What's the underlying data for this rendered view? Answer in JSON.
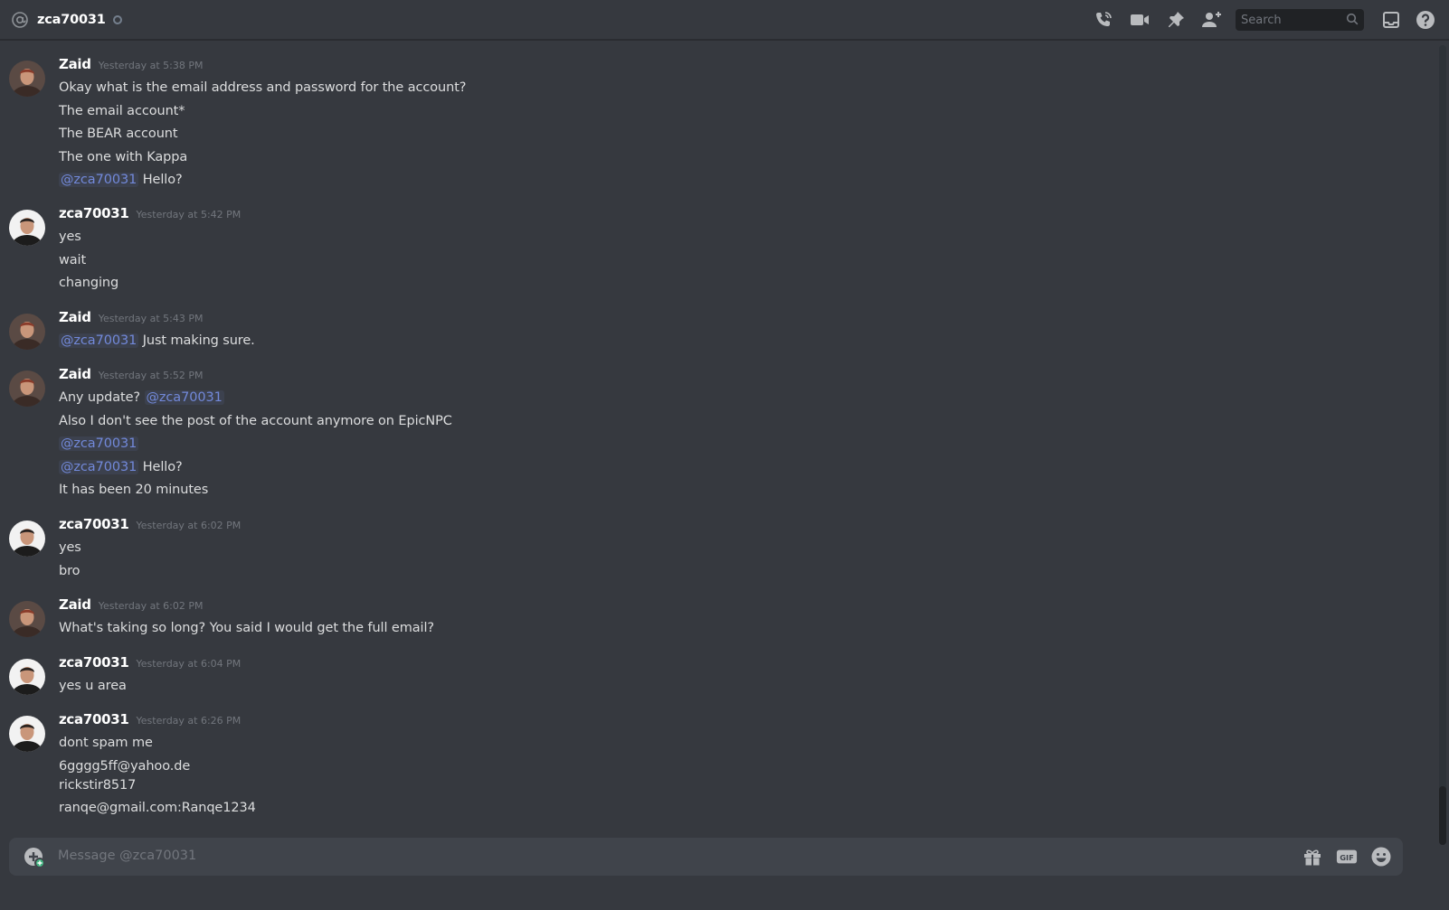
{
  "header": {
    "title": "zca70031",
    "search_placeholder": "Search",
    "icons": [
      "at-icon",
      "call-icon",
      "video-icon",
      "pin-icon",
      "add-friend-icon",
      "search-icon",
      "inbox-icon",
      "help-icon"
    ]
  },
  "colors": {
    "background": "#36393f",
    "mention": "#7289da",
    "timestamp": "#72767d",
    "text": "#dcddde",
    "username": "#ffffff",
    "composer": "#40444b"
  },
  "messages": [
    {
      "author": "Zaid",
      "timestamp": "Yesterday at 5:38 PM",
      "lines": [
        {
          "text": "Okay what is the email address and password for the account?"
        },
        {
          "text": "The email account*"
        },
        {
          "text": "The BEAR account"
        },
        {
          "text": "The one with Kappa"
        },
        {
          "mention": "@zca70031",
          "text": " Hello?"
        }
      ]
    },
    {
      "author": "zca70031",
      "timestamp": "Yesterday at 5:42 PM",
      "lines": [
        {
          "text": "yes"
        },
        {
          "text": "wait"
        },
        {
          "text": "changing"
        }
      ]
    },
    {
      "author": "Zaid",
      "timestamp": "Yesterday at 5:43 PM",
      "lines": [
        {
          "mention": "@zca70031",
          "text": " Just making sure."
        }
      ]
    },
    {
      "author": "Zaid",
      "timestamp": "Yesterday at 5:52 PM",
      "lines": [
        {
          "text": "Any update? ",
          "mention_after": "@zca70031"
        },
        {
          "text": "Also I don't see the post of the account anymore on EpicNPC"
        },
        {
          "mention": "@zca70031",
          "text": ""
        },
        {
          "mention": "@zca70031",
          "text": " Hello?"
        },
        {
          "text": "It has been 20 minutes"
        }
      ]
    },
    {
      "author": "zca70031",
      "timestamp": "Yesterday at 6:02 PM",
      "lines": [
        {
          "text": "yes"
        },
        {
          "text": "bro"
        }
      ]
    },
    {
      "author": "Zaid",
      "timestamp": "Yesterday at 6:02 PM",
      "lines": [
        {
          "text": "What's taking so long? You said I would get the full email?"
        }
      ]
    },
    {
      "author": "zca70031",
      "timestamp": "Yesterday at 6:04 PM",
      "lines": [
        {
          "text": "yes u area"
        }
      ]
    },
    {
      "author": "zca70031",
      "timestamp": "Yesterday at 6:26 PM",
      "lines": [
        {
          "text": "dont spam me"
        },
        {
          "text": "6gggg5ff@yahoo.de"
        },
        {
          "text": "rickstir8517"
        },
        {
          "text": "ranqe@gmail.com:Ranqe1234"
        }
      ]
    }
  ],
  "composer": {
    "placeholder": "Message @zca70031",
    "icons": [
      "upload-icon",
      "gift-icon",
      "gif-icon",
      "emoji-icon"
    ],
    "gif_label": "GIF"
  }
}
